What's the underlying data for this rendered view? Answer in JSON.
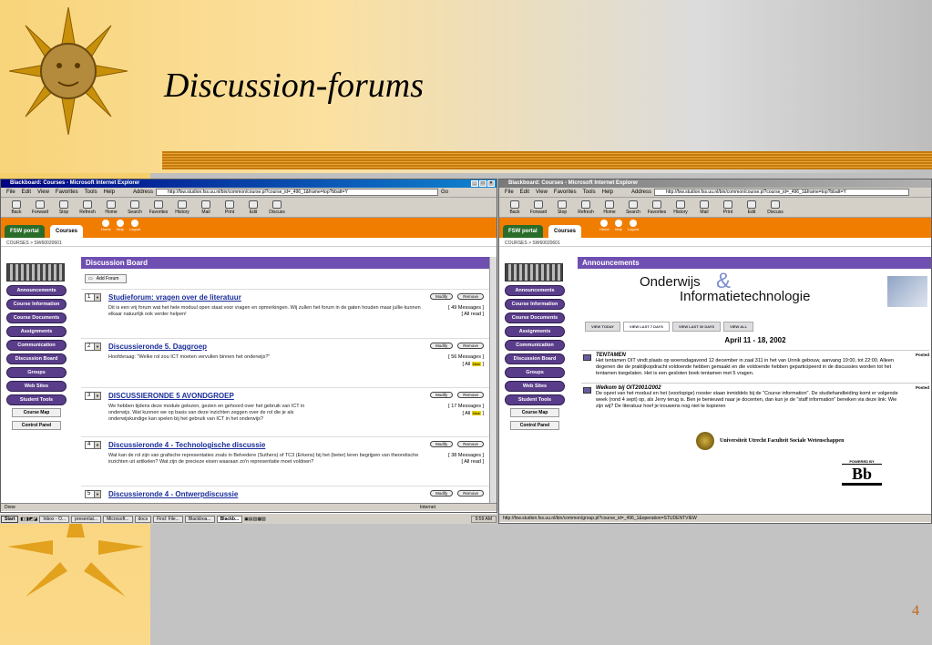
{
  "slide": {
    "title": "Discussion-forums",
    "number": "4"
  },
  "left": {
    "window_title": "Blackboard: Courses - Microsoft Internet Explorer",
    "menu": [
      "File",
      "Edit",
      "View",
      "Favorites",
      "Tools",
      "Help"
    ],
    "address_label": "Address",
    "address_url": "http://fsw.studion.fss.uu.nl/bin/common/course.pl?course_id=_496_1&frame=top?bbatt=Y",
    "go": "Go",
    "toolbar": [
      "Back",
      "Forward",
      "Stop",
      "Refresh",
      "Home",
      "Search",
      "Favorites",
      "History",
      "Mail",
      "Print",
      "Edit",
      "Discuss"
    ],
    "tabs": [
      "FSW portal",
      "Courses"
    ],
    "header_icons": [
      "Home",
      "Help",
      "Logout"
    ],
    "breadcrumb": "COURSES > SW60020601",
    "nav": [
      "Announcements",
      "Course Information",
      "Course Documents",
      "Assignments",
      "Communication",
      "Discussion Board",
      "Groups",
      "Web Sites",
      "Student Tools"
    ],
    "nav_plain": [
      "Course Map",
      "Control Panel"
    ],
    "content_title": "Discussion Board",
    "add_forum": "Add Forum",
    "modify": "Modify",
    "remove": "Remove",
    "forums": [
      {
        "num": "1",
        "title": "Studieforum: vragen over de literatuur",
        "desc": "Dit is een vrij forum wat het hele moduul open staat voor vragen en opmerkingen. Wij zullen het forum in de gaten houden maar jullie kunnen elkaar natuurlijk ook verder helpen!",
        "messages": "[ 49 Messages ]",
        "read": "[ All read ]",
        "new": ""
      },
      {
        "num": "2",
        "title": "Discussieronde 5. Daggroep",
        "desc": "Hoofdvraag: \"Welke rol zou ICT moeten vervullen binnen het onderwijs?\"",
        "messages": "[ 56 Messages ]",
        "read": "[ All",
        "new": "New"
      },
      {
        "num": "3",
        "title": "DISCUSSIERONDE 5 AVONDGROEP",
        "desc": "We hebben tijdens deze module gelezen, gezien en gehoord over het gebruik van ICT in onderwijs. Wat kunnen we op basis van deze inzichten zeggen over de rol die je als onderwijskundige kan spelen bij het gebruik van ICT in het onderwijs?",
        "messages": "[ 17 Messages ]",
        "read": "[ All",
        "new": "New"
      },
      {
        "num": "4",
        "title": "Discussieronde 4 - Technologische discussie",
        "desc": "Wat kan de rol zijn van grafische representaties zoals in Belvedere (Suthers) of TC3 (Erkens) bij het (beter) leren begrijpen van theoretische inzichten uit artikelen? Wat zijn de precieze eisen waaraan zo'n representatie moet voldoen?",
        "messages": "[ 38 Messages ]",
        "read": "[ All read ]",
        "new": ""
      },
      {
        "num": "5",
        "title": "Discussieronde 4 - Ontwerpdiscussie",
        "desc": "",
        "messages": "",
        "read": "",
        "new": ""
      }
    ],
    "status": "Done",
    "zone": "Internet"
  },
  "taskbar": {
    "start": "Start",
    "tasks": [
      "Inbox - O...",
      "presentat...",
      "Microsoft...",
      "docs",
      "Find: File...",
      "Blackboa...",
      "Blackb..."
    ],
    "clock": "9:59 AM"
  },
  "right": {
    "window_title": "Blackboard: Courses - Microsoft Internet Explorer",
    "address_url": "http://fsw.studion.fss.uu.nl/bin/common/course.pl?course_id=_496_1&frame=top?bbatt=Y",
    "content_title": "Announcements",
    "banner1": "Onderwijs",
    "banner_amp": "&",
    "banner2": "Informatietechnologie",
    "view_tabs": [
      "VIEW TODAY",
      "VIEW LAST 7 DAYS",
      "VIEW LAST 30 DAYS",
      "VIEW ALL"
    ],
    "date_range": "April 11 - 18, 2002",
    "posted": "Posted",
    "announcements": [
      {
        "title": "TENTAMEN",
        "body": "Het tentamen OIT vindt plaats op woensdagavond 12 december in zaal 311 in het van Unnik gebouw, aanvang 19:00, tot 22:00. Alleen degenen die de praktijkopdracht voldoende hebben gemaakt en die voldoende hebben geparticipeerd in de discussies worden tot het tentamen toegelaten. Het is een gesloten boek tentamen met 5 vragen."
      },
      {
        "title": "Welkom bij OIT2001/2002",
        "body": "De opzet van het moduul en het (voorlopige) rooster staan inmiddels bij de \"Course information\". De studiehandleiding komt er volgende week (rond 4 sept) op, als Jerry terug is. Ben je benieuwd naar je docenten, dan kun je de \"staff information\" bereiken via deze link: Wie zijn wij? De literatuur hoef je trouwens nog niet te kopieren"
      }
    ],
    "uu_name": "Universiteit Utrecht  Faculteit Sociale Wetenschappen",
    "powered_by": "POWERED BY",
    "bb_logo": "Bb",
    "status_url": "http://fsw.studion.fss.uu.nl/bin/common/group.pl?course_id=_496_1&operation=STUDENTVIEW"
  }
}
